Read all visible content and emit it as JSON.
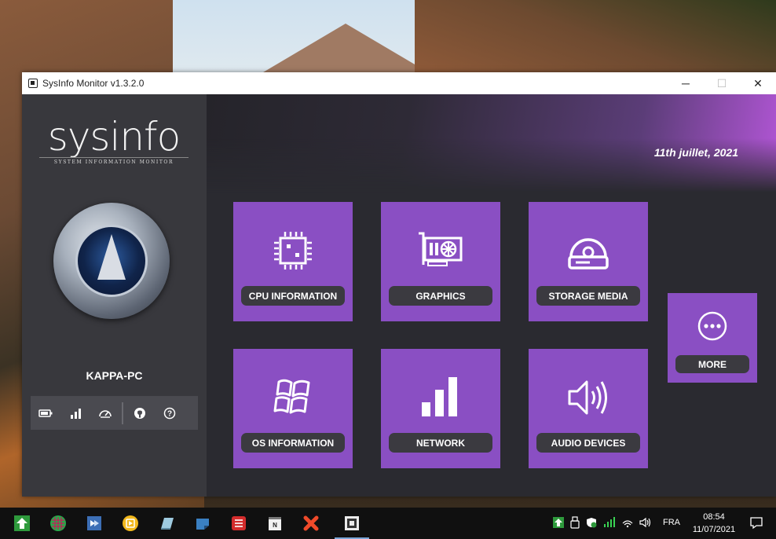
{
  "window": {
    "title": "SysInfo Monitor v1.3.2.0",
    "minimize_glyph": "─",
    "maximize_glyph": "☐",
    "close_glyph": "✕"
  },
  "sidebar": {
    "logo_text": "sysinfo",
    "logo_subtitle": "SYSTEM INFORMATION MONITOR",
    "pc_name": "KAPPA-PC",
    "status_icons": [
      "battery-icon",
      "signal-bars-icon",
      "speedometer-icon",
      "github-icon",
      "help-icon"
    ]
  },
  "header": {
    "date": "11th juillet, 2021"
  },
  "tiles": [
    {
      "label": "CPU INFORMATION",
      "icon": "cpu-icon"
    },
    {
      "label": "GRAPHICS",
      "icon": "graphics-card-icon"
    },
    {
      "label": "STORAGE MEDIA",
      "icon": "hard-drive-icon"
    },
    {
      "label": "OS INFORMATION",
      "icon": "windows-icon"
    },
    {
      "label": "NETWORK",
      "icon": "network-bars-icon"
    },
    {
      "label": "AUDIO DEVICES",
      "icon": "speaker-icon"
    },
    {
      "label": "MORE",
      "icon": "more-icon"
    }
  ],
  "colors": {
    "tile": "#8a4fc3",
    "label_pill": "#3b3a40",
    "sidebar": "#38383d",
    "main": "#2a2a30",
    "accent_gradient_end": "#b256d6"
  },
  "taskbar": {
    "language": "FRA",
    "time": "08:54",
    "date": "11/07/2021"
  }
}
